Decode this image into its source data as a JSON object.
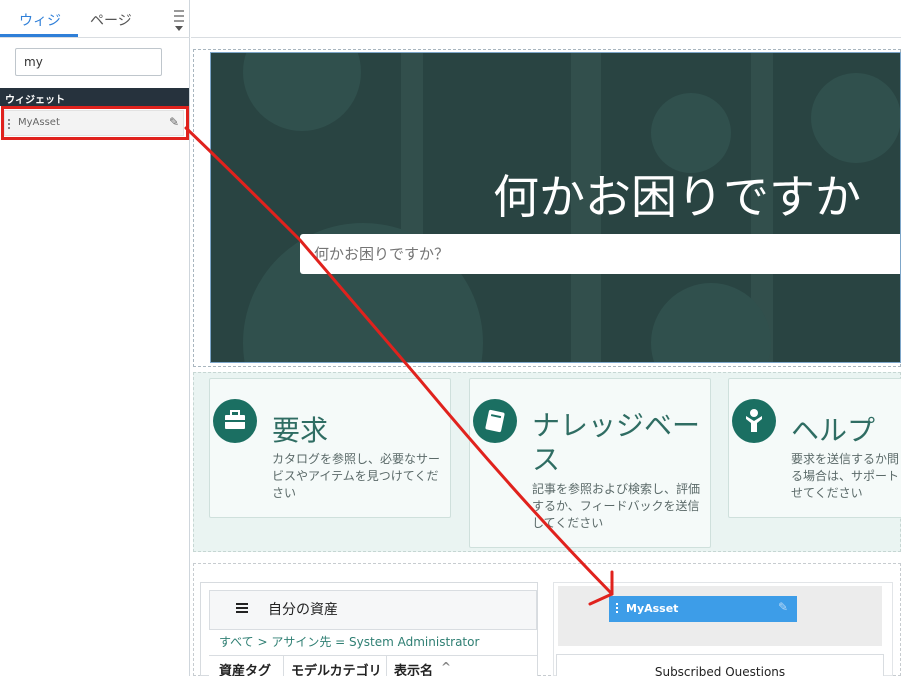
{
  "left_panel": {
    "tabs": [
      {
        "label": "ウィジ",
        "active": true
      },
      {
        "label": "ページ",
        "active": false
      }
    ],
    "search": {
      "value": "my",
      "placeholder": ""
    },
    "section_header": "ウィジェット",
    "widgets": [
      {
        "label": "MyAsset",
        "icon": "pencil-icon"
      }
    ]
  },
  "hero": {
    "title": "何かお困りですか",
    "search_placeholder": "何かお困りですか？"
  },
  "cards": [
    {
      "title": "要求",
      "description": "カタログを参照し、必要なサービスやアイテムを見つけてください",
      "icon": "briefcase-icon"
    },
    {
      "title": "ナレッジベース",
      "description": "記事を参照および検索し、評価するか、フィードバックを送信してください",
      "icon": "book-icon"
    },
    {
      "title": "ヘルプ",
      "description": "要求を送信するか問る場合は、サポートせてください",
      "icon": "person-icon"
    }
  ],
  "asset_widget": {
    "title": "自分の資産",
    "breadcrumb": "すべて > アサイン先 = System Administrator",
    "columns": [
      "資産タグ",
      "モデルカテゴリ",
      "表示名"
    ]
  },
  "drop_target": {
    "chip_label": "MyAsset",
    "subscribed_title": "Subscribed Questions"
  },
  "colors": {
    "accent": "#2f7fd8",
    "hero_bg": "#294442",
    "card_icon": "#1b6f62",
    "annotation_red": "#e0221d",
    "drop_chip": "#3d9de8"
  }
}
